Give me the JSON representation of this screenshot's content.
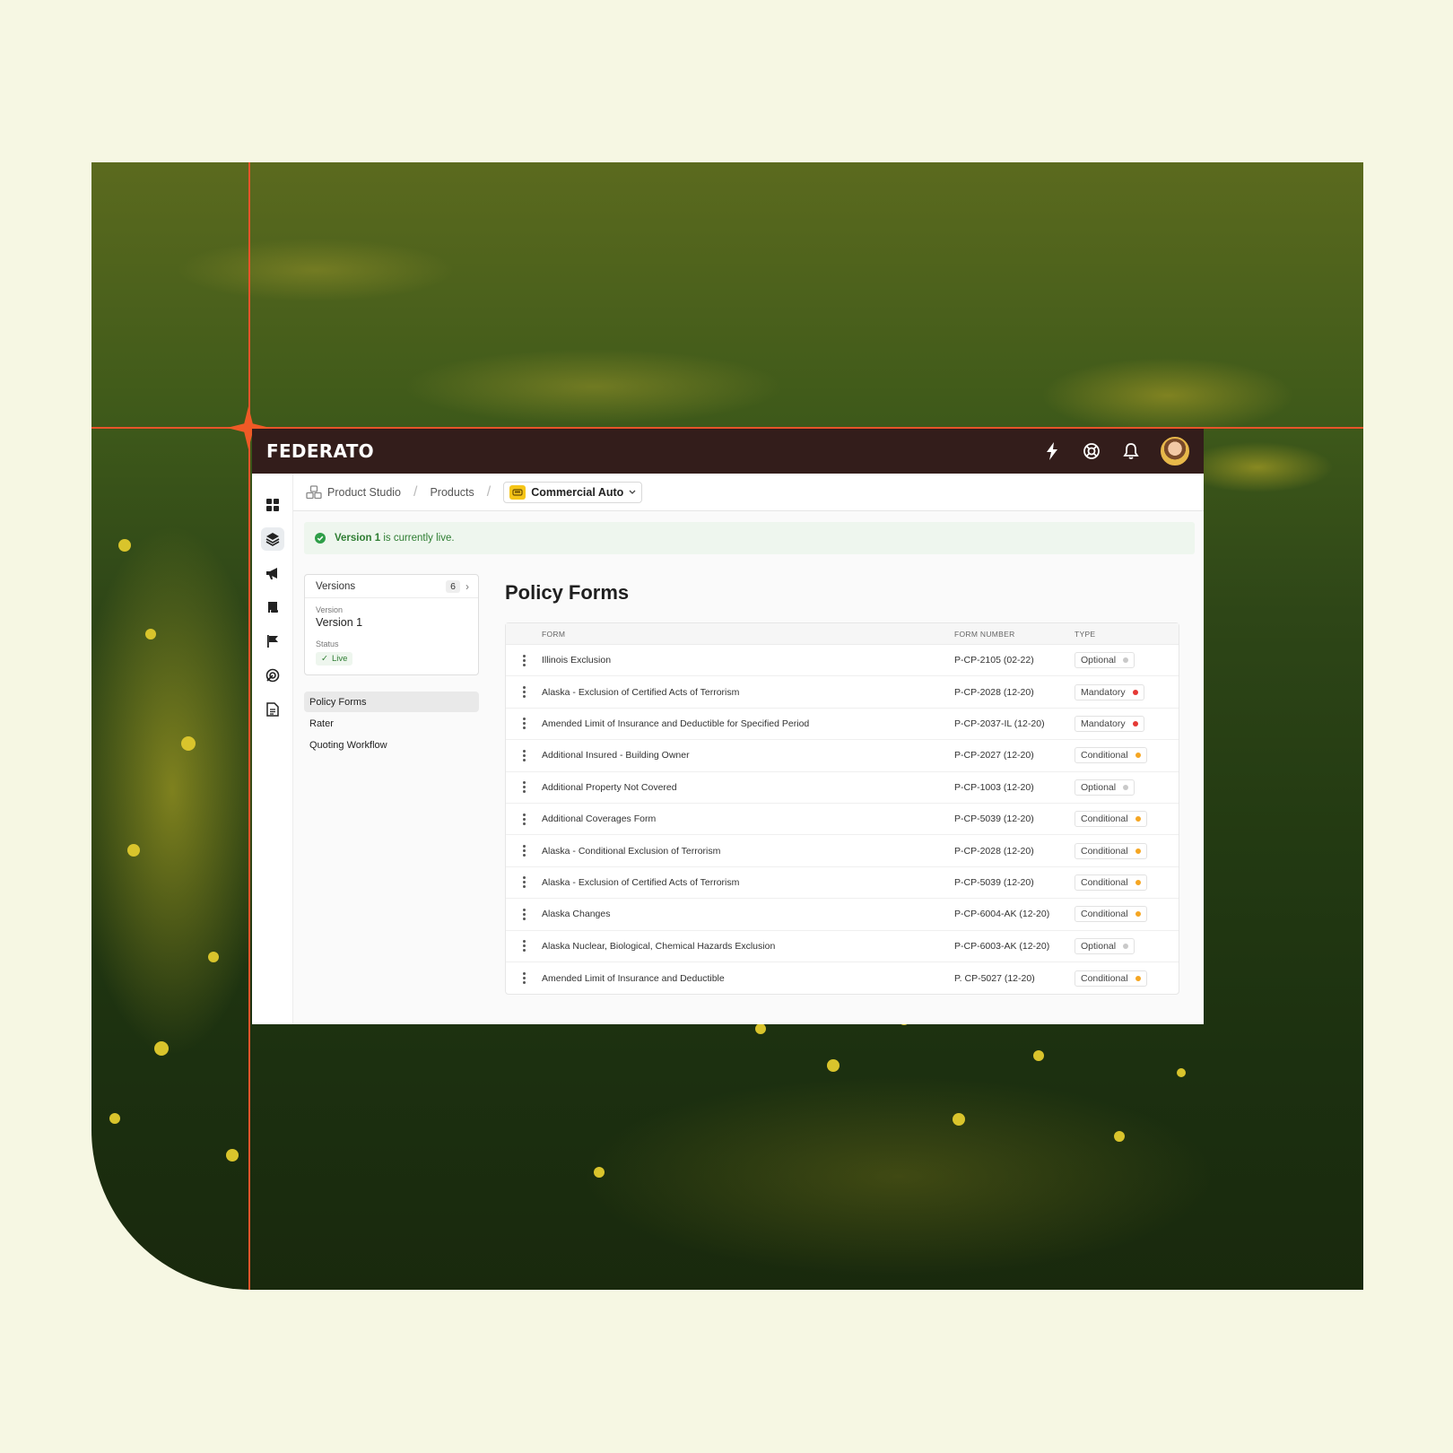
{
  "app": {
    "brand": "FEDERATO"
  },
  "breadcrumb": {
    "items": [
      "Product Studio",
      "Products"
    ],
    "selected": "Commercial Auto"
  },
  "banner": {
    "version": "Version 1",
    "text": " is currently live."
  },
  "versions": {
    "label": "Versions",
    "count": "6",
    "version_label": "Version",
    "version_value": "Version 1",
    "status_label": "Status",
    "status_value": "Live"
  },
  "subnav": [
    "Policy Forms",
    "Rater",
    "Quoting Workflow"
  ],
  "page": {
    "title": "Policy Forms"
  },
  "table": {
    "columns": [
      "FORM",
      "FORM NUMBER",
      "TYPE"
    ],
    "rows": [
      {
        "form": "Illinois Exclusion",
        "number": "P-CP-2105 (02-22)",
        "type": "Optional"
      },
      {
        "form": "Alaska - Exclusion of Certified Acts of Terrorism",
        "number": "P-CP-2028 (12-20)",
        "type": "Mandatory"
      },
      {
        "form": "Amended Limit of Insurance and Deductible for Specified Period",
        "number": "P-CP-2037-IL (12-20)",
        "type": "Mandatory"
      },
      {
        "form": "Additional Insured - Building Owner",
        "number": "P-CP-2027 (12-20)",
        "type": "Conditional"
      },
      {
        "form": "Additional Property Not Covered",
        "number": "P-CP-1003 (12-20)",
        "type": "Optional"
      },
      {
        "form": "Additional Coverages Form",
        "number": "P-CP-5039 (12-20)",
        "type": "Conditional"
      },
      {
        "form": "Alaska - Conditional Exclusion of Terrorism",
        "number": "P-CP-2028 (12-20)",
        "type": "Conditional"
      },
      {
        "form": "Alaska - Exclusion of Certified Acts of Terrorism",
        "number": "P-CP-5039 (12-20)",
        "type": "Conditional"
      },
      {
        "form": "Alaska Changes",
        "number": "P-CP-6004-AK (12-20)",
        "type": "Conditional"
      },
      {
        "form": "Alaska Nuclear, Biological, Chemical Hazards Exclusion",
        "number": "P-CP-6003-AK (12-20)",
        "type": "Optional"
      },
      {
        "form": "Amended Limit of Insurance and Deductible",
        "number": "P. CP-5027 (12-20)",
        "type": "Conditional"
      }
    ]
  },
  "colors": {
    "accent": "#e8542a",
    "topbar": "#331d1b",
    "optional": "#c9c9c9",
    "mandatory": "#e53935",
    "conditional": "#f5a623",
    "live": "#2e7d32"
  },
  "icons": {
    "rail": [
      "grid-icon",
      "layers-icon",
      "megaphone-icon",
      "scroll-icon",
      "flag-icon",
      "radar-icon",
      "document-icon"
    ],
    "topbar": [
      "lightning-icon",
      "lifebuoy-icon",
      "bell-icon"
    ]
  }
}
